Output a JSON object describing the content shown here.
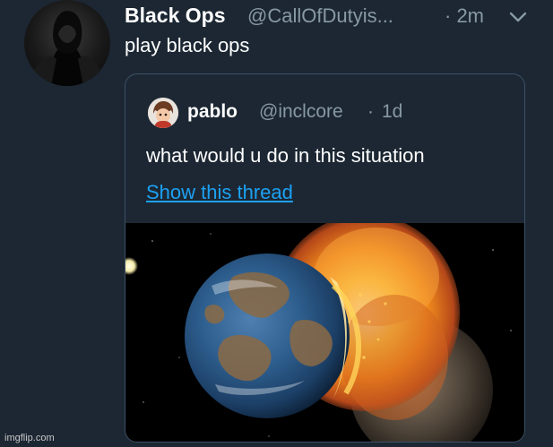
{
  "tweet": {
    "display_name": "Black Ops",
    "handle": "@CallOfDutyis...",
    "time": "· 2m",
    "text": "play black ops",
    "menu_icon": "chevron-down-icon",
    "avatar_icon": "profile-avatar"
  },
  "quoted_tweet": {
    "display_name": "pablo",
    "handle": "@inclcore",
    "separator": "·",
    "time": "1d",
    "text": "what would u do in this situation",
    "link_text": "Show this thread",
    "media": "planet-collision-image"
  },
  "watermark": "imgflip.com",
  "colors": {
    "background": "#1c2733",
    "secondary_text": "#8899a6",
    "link": "#1da1f2",
    "card_border": "#3d5166"
  }
}
